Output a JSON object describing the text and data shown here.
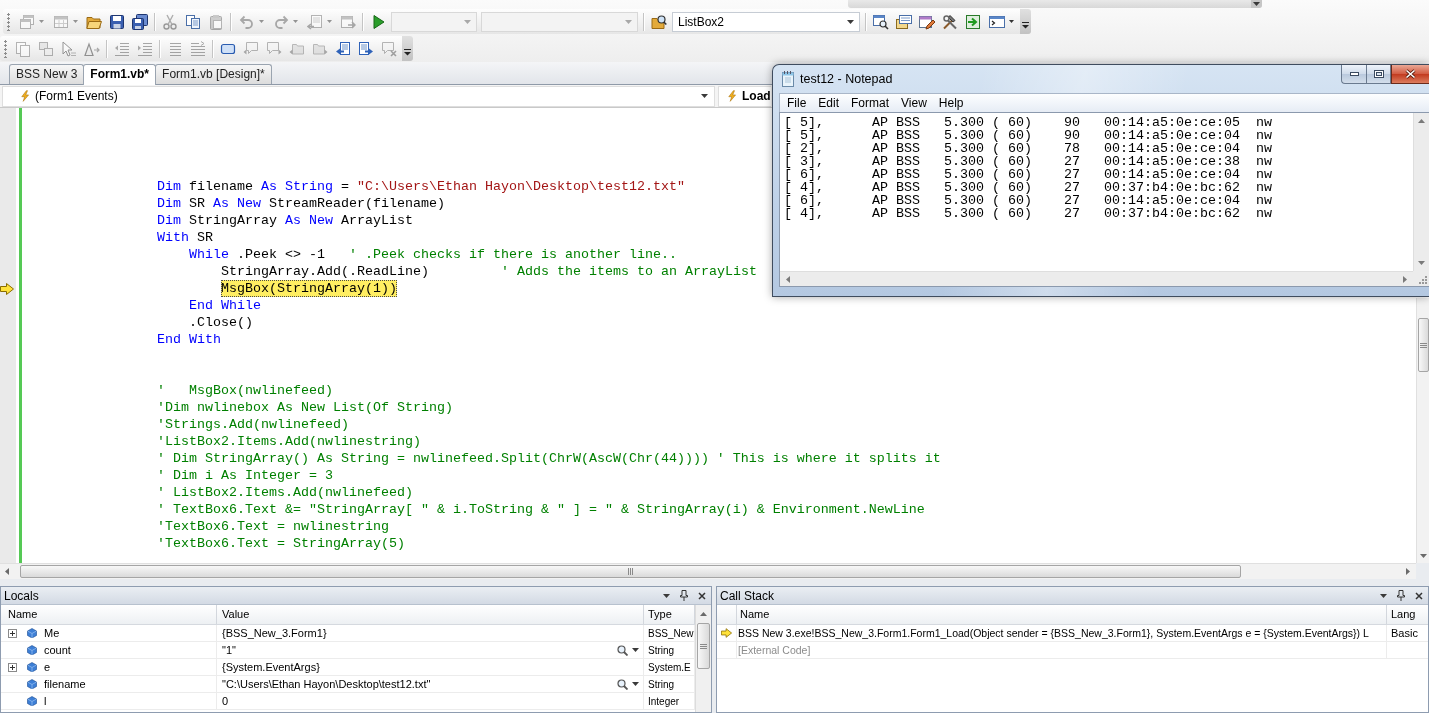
{
  "toolbars": [
    {
      "items": [
        {
          "kind": "button",
          "disabled": true,
          "dropdown": true
        },
        {
          "kind": "button",
          "disabled": true,
          "dropdown": true
        },
        {
          "kind": "button",
          "disabled": false,
          "dropdown": false
        },
        {
          "kind": "button",
          "disabled": false,
          "dropdown": false
        },
        {
          "kind": "button",
          "disabled": false,
          "dropdown": false
        },
        {
          "kind": "separator"
        },
        {
          "kind": "button",
          "disabled": true,
          "dropdown": false
        },
        {
          "kind": "button",
          "disabled": false,
          "dropdown": false
        },
        {
          "kind": "button",
          "disabled": true,
          "dropdown": false
        },
        {
          "kind": "separator"
        },
        {
          "kind": "button",
          "disabled": true,
          "dropdown": true
        },
        {
          "kind": "button",
          "disabled": true,
          "dropdown": true
        },
        {
          "kind": "button",
          "disabled": true,
          "dropdown": true
        },
        {
          "kind": "button",
          "disabled": true,
          "dropdown": false
        },
        {
          "kind": "separator"
        },
        {
          "kind": "button",
          "disabled": false,
          "dropdown": false
        },
        {
          "kind": "combo",
          "disabled": true
        },
        {
          "kind": "combo",
          "disabled": true
        },
        {
          "kind": "separator"
        },
        {
          "kind": "button",
          "disabled": false,
          "dropdown": false
        },
        {
          "kind": "combo",
          "disabled": false,
          "value": "ListBox2"
        },
        {
          "kind": "separator"
        },
        {
          "kind": "button",
          "disabled": false,
          "dropdown": false
        },
        {
          "kind": "button",
          "disabled": false,
          "dropdown": false
        },
        {
          "kind": "button",
          "disabled": false,
          "dropdown": false
        },
        {
          "kind": "button",
          "disabled": false,
          "dropdown": false
        },
        {
          "kind": "button",
          "disabled": false,
          "dropdown": false
        },
        {
          "kind": "button",
          "disabled": false,
          "dropdown": true
        }
      ]
    },
    {
      "items": [
        {
          "kind": "button",
          "disabled": true,
          "dropdown": false
        },
        {
          "kind": "button",
          "disabled": true,
          "dropdown": false
        },
        {
          "kind": "button",
          "disabled": true,
          "dropdown": false
        },
        {
          "kind": "button",
          "disabled": true,
          "dropdown": false
        },
        {
          "kind": "separator"
        },
        {
          "kind": "button",
          "disabled": true,
          "dropdown": false
        },
        {
          "kind": "button",
          "disabled": true,
          "dropdown": false
        },
        {
          "kind": "separator"
        },
        {
          "kind": "button",
          "disabled": true,
          "dropdown": false
        },
        {
          "kind": "button",
          "disabled": true,
          "dropdown": false
        },
        {
          "kind": "separator"
        },
        {
          "kind": "button",
          "disabled": false,
          "dropdown": false
        },
        {
          "kind": "button",
          "disabled": true,
          "dropdown": false
        },
        {
          "kind": "button",
          "disabled": true,
          "dropdown": false
        },
        {
          "kind": "button",
          "disabled": true,
          "dropdown": false
        },
        {
          "kind": "button",
          "disabled": true,
          "dropdown": false
        },
        {
          "kind": "button",
          "disabled": false,
          "dropdown": false
        },
        {
          "kind": "button",
          "disabled": false,
          "dropdown": false
        },
        {
          "kind": "button",
          "disabled": true,
          "dropdown": false
        }
      ]
    }
  ],
  "tabs": [
    {
      "label": "BSS New 3",
      "selected": false
    },
    {
      "label": "Form1.vb*",
      "selected": true
    },
    {
      "label": "Form1.vb [Design]*",
      "selected": false
    }
  ],
  "nav_bar": {
    "left_combo": {
      "value": "(Form1 Events)"
    },
    "right_combo": {
      "value": "Load"
    }
  },
  "editor": {
    "blocks": [
      {
        "lines": [
          {
            "tokens": [
              {
                "kind": "keyword",
                "text": "Dim"
              },
              {
                "kind": "plain",
                "text": " filename "
              },
              {
                "kind": "keyword",
                "text": "As String"
              },
              {
                "kind": "plain",
                "text": " = "
              },
              {
                "kind": "string",
                "text": "\"C:\\Users\\Ethan Hayon\\Desktop\\test12.txt\""
              }
            ],
            "current": false
          },
          {
            "tokens": [
              {
                "kind": "keyword",
                "text": "Dim"
              },
              {
                "kind": "plain",
                "text": " SR "
              },
              {
                "kind": "keyword",
                "text": "As New"
              },
              {
                "kind": "plain",
                "text": " StreamReader(filename)"
              }
            ],
            "current": false
          },
          {
            "tokens": [
              {
                "kind": "keyword",
                "text": "Dim"
              },
              {
                "kind": "plain",
                "text": " StringArray "
              },
              {
                "kind": "keyword",
                "text": "As New"
              },
              {
                "kind": "plain",
                "text": " ArrayList"
              }
            ],
            "current": false
          },
          {
            "tokens": [
              {
                "kind": "keyword",
                "text": "With"
              },
              {
                "kind": "plain",
                "text": " SR"
              }
            ],
            "current": false,
            "children": [
              {
                "tokens": [
                  {
                    "kind": "keyword",
                    "text": "While"
                  },
                  {
                    "kind": "plain",
                    "text": " .Peek <> -1   "
                  },
                  {
                    "kind": "comment",
                    "text": "' .Peek checks if there is another line.."
                  }
                ],
                "current": false,
                "children": [
                  {
                    "tokens": [
                      {
                        "kind": "plain",
                        "text": "StringArray.Add(.ReadLine)         "
                      },
                      {
                        "kind": "comment",
                        "text": "' Adds the items to an ArrayList"
                      }
                    ],
                    "current": false
                  },
                  {
                    "tokens": [
                      {
                        "kind": "plain",
                        "text": "MsgBox(StringArray(1))"
                      }
                    ],
                    "current": true
                  }
                ]
              },
              {
                "tokens": [
                  {
                    "kind": "keyword",
                    "text": "End While"
                  }
                ],
                "current": false
              },
              {
                "tokens": [
                  {
                    "kind": "plain",
                    "text": ".Close()"
                  }
                ],
                "current": false
              }
            ]
          },
          {
            "tokens": [
              {
                "kind": "keyword",
                "text": "End With"
              }
            ],
            "current": false
          }
        ]
      },
      {
        "lines": [
          {
            "tokens": [
              {
                "kind": "comment",
                "text": "'   MsgBox(nwlinefeed)"
              }
            ],
            "current": false
          },
          {
            "tokens": [
              {
                "kind": "comment",
                "text": "'Dim nwlinebox As New List(Of String)"
              }
            ],
            "current": false
          },
          {
            "tokens": [
              {
                "kind": "comment",
                "text": "'Strings.Add(nwlinefeed)"
              }
            ],
            "current": false
          },
          {
            "tokens": [
              {
                "kind": "comment",
                "text": "'ListBox2.Items.Add(nwlinestring)"
              }
            ],
            "current": false
          },
          {
            "tokens": [
              {
                "kind": "comment",
                "text": "' Dim StringArray() As String = nwlinefeed.Split(ChrW(AscW(Chr(44)))) ' This is where it splits it"
              }
            ],
            "current": false
          },
          {
            "tokens": [
              {
                "kind": "comment",
                "text": "' Dim i As Integer = 3"
              }
            ],
            "current": false
          },
          {
            "tokens": [
              {
                "kind": "comment",
                "text": "' ListBox2.Items.Add(nwlinefeed)"
              }
            ],
            "current": false
          },
          {
            "tokens": [
              {
                "kind": "comment",
                "text": "' TextBox6.Text &= \"StringArray[ \" & i.ToString & \" ] = \" & StringArray(i) & Environment.NewLine"
              }
            ],
            "current": false
          },
          {
            "tokens": [
              {
                "kind": "comment",
                "text": "'TextBox6.Text = nwlinestring"
              }
            ],
            "current": false
          },
          {
            "tokens": [
              {
                "kind": "comment",
                "text": "'TextBox6.Text = StringArray(5)"
              }
            ],
            "current": false
          }
        ]
      }
    ]
  },
  "notepad": {
    "title": "test12 - Notepad",
    "menu": [
      "File",
      "Edit",
      "Format",
      "View",
      "Help"
    ],
    "lines": [
      "[ 5],      AP BSS   5.300 ( 60)    90   00:14:a5:0e:ce:05  nw",
      "[ 5],      AP BSS   5.300 ( 60)    90   00:14:a5:0e:ce:04  nw",
      "[ 2],      AP BSS   5.300 ( 60)    78   00:14:a5:0e:ce:04  nw",
      "[ 3],      AP BSS   5.300 ( 60)    27   00:14:a5:0e:ce:38  nw",
      "[ 6],      AP BSS   5.300 ( 60)    27   00:14:a5:0e:ce:04  nw",
      "[ 4],      AP BSS   5.300 ( 60)    27   00:37:b4:0e:bc:62  nw",
      "[ 6],      AP BSS   5.300 ( 60)    27   00:14:a5:0e:ce:04  nw",
      "[ 4],      AP BSS   5.300 ( 60)    27   00:37:b4:0e:bc:62  nw"
    ]
  },
  "locals": {
    "title": "Locals",
    "columns": [
      "Name",
      "Value",
      "Type"
    ],
    "rows": [
      {
        "name": "Me",
        "value": "{BSS_New_3.Form1}",
        "type": "BSS_New",
        "expandable": true,
        "visualizer": false
      },
      {
        "name": "count",
        "value": "\"1\"",
        "type": "String",
        "expandable": false,
        "visualizer": true
      },
      {
        "name": "e",
        "value": "{System.EventArgs}",
        "type": "System.E",
        "expandable": true,
        "visualizer": false
      },
      {
        "name": "filename",
        "value": "\"C:\\Users\\Ethan Hayon\\Desktop\\test12.txt\"",
        "type": "String",
        "expandable": false,
        "visualizer": true
      },
      {
        "name": "l",
        "value": "0",
        "type": "Integer",
        "expandable": false,
        "visualizer": false
      }
    ]
  },
  "call_stack": {
    "title": "Call Stack",
    "columns": [
      "Name",
      "Lang"
    ],
    "rows": [
      {
        "name": "BSS New 3.exe!BSS_New_3.Form1.Form1_Load(Object sender = {BSS_New_3.Form1}, System.EventArgs e = {System.EventArgs}) L",
        "lang": "Basic",
        "current": true,
        "external": false
      },
      {
        "name": "[External Code]",
        "current": false,
        "external": true
      }
    ]
  }
}
